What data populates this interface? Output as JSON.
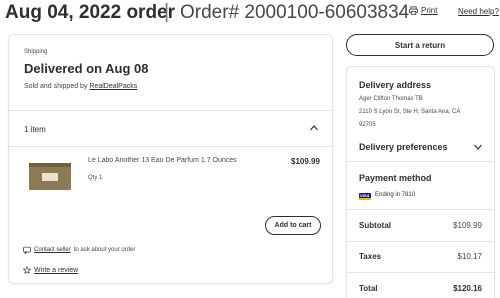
{
  "header": {
    "order_date_title": "Aug 04, 2022 order",
    "separator": "|",
    "order_number": "Order# 2000100-60603834",
    "print_label": "Print",
    "help_label": "Need help?"
  },
  "shipment": {
    "label": "Shipping",
    "status": "Delivered on Aug 08",
    "sold_by_prefix": "Sold and shipped by",
    "seller": "RealDealPacks",
    "items_count": "1 item"
  },
  "item": {
    "name": "Le Labo Another 13 Eau De Parfum 1.7 Ounces",
    "qty": "Qty 1",
    "price": "$109.99",
    "add_to_cart_label": "Add to cart"
  },
  "seller_actions": {
    "contact_link": "Contact seller",
    "contact_suffix": "to ask about your order",
    "review_link": "Write a review"
  },
  "sidebar": {
    "return_label": "Start a return",
    "delivery_address_heading": "Delivery address",
    "name": "Ager Clifton Thomas TB",
    "street": "2110 S Lyon St, Ste H, Santa Ana, CA",
    "zip": "92705",
    "delivery_prefs_heading": "Delivery preferences",
    "payment_heading": "Payment method",
    "card_brand": "VISA",
    "card_ending": "Ending in 7810",
    "subtotal_label": "Subtotal",
    "subtotal_value": "$109.99",
    "taxes_label": "Taxes",
    "taxes_value": "$10.17",
    "total_label": "Total",
    "total_value": "$120.16"
  },
  "icons": {
    "print": "print-icon",
    "chevron_up": "chevron-up-icon",
    "chevron_down": "chevron-down-icon",
    "message": "message-icon",
    "star": "star-icon"
  },
  "colors": {
    "text": "#2e2f32",
    "border": "#e3e4e5",
    "visa_blue": "#1a1f71",
    "visa_gold": "#f7b600"
  }
}
